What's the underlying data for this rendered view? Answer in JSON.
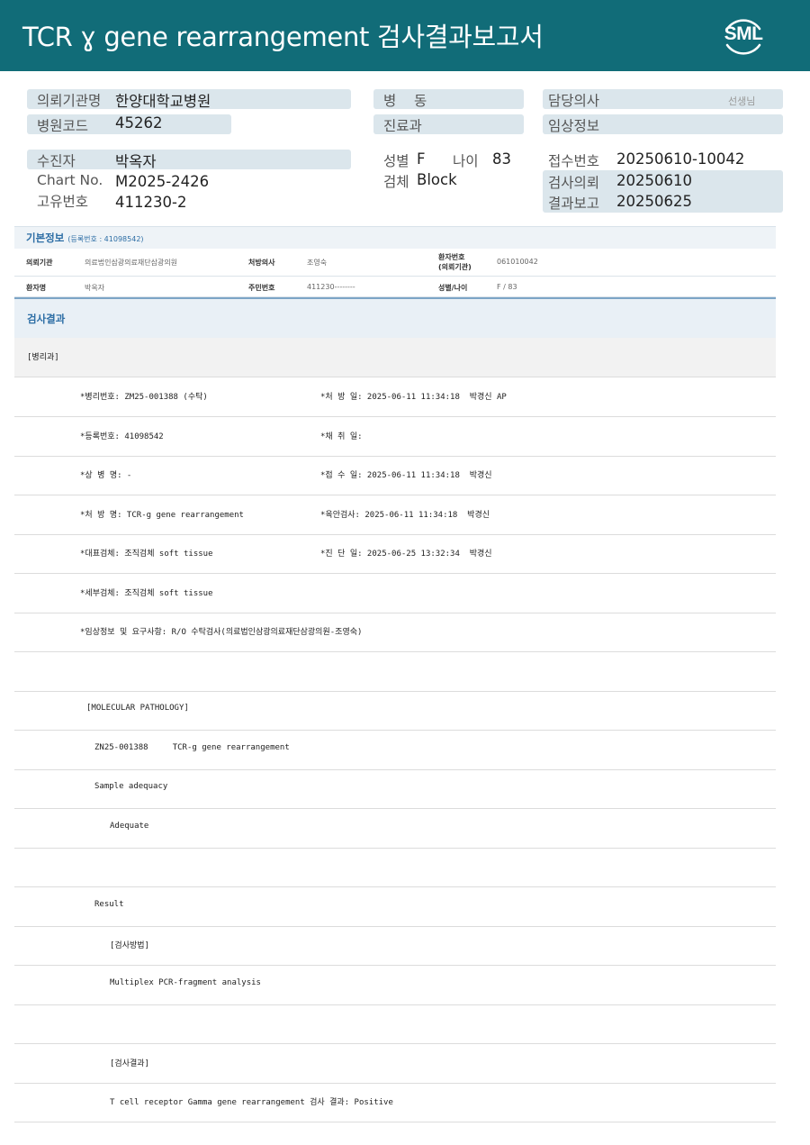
{
  "header": {
    "title": "TCR ɣ gene rearrangement 검사결과보고서",
    "logo_text": "SML"
  },
  "info": {
    "institution_label": "의뢰기관명",
    "institution_value": "한양대학교병원",
    "hospital_code_label": "병원코드",
    "hospital_code_value": "45262",
    "ward_label": "병    동",
    "department_label": "진료과",
    "doctor_label": "담당의사",
    "doctor_suffix": "선생님",
    "clinical_label": "임상정보",
    "patient_label": "수진자",
    "patient_value": "박옥자",
    "chart_label": "Chart No.",
    "chart_value": "M2025-2426",
    "unique_label": "고유번호",
    "unique_value": "411230-2",
    "sex_label": "성별",
    "sex_value": "F",
    "age_label": "나이",
    "age_value": "83",
    "specimen_label": "검체",
    "specimen_value": "Block",
    "receipt_label": "접수번호",
    "receipt_value": "20250610-10042",
    "request_label": "검사의뢰",
    "request_value": "20250610",
    "report_label": "결과보고",
    "report_value": "20250625"
  },
  "basic": {
    "title": "기본정보",
    "reg_no": "(등록번호 : 41098542)",
    "rows": [
      {
        "k1": "의뢰기관",
        "v1": "의료법인삼광의료재단삼광의원",
        "k2": "처방의사",
        "v2": "조영숙",
        "k3a": "환자번호",
        "k3b": "(의뢰기관)",
        "v3": "061010042"
      },
      {
        "k1": "환자명",
        "v1": "박옥자",
        "k2": "주민번호",
        "v2": "411230--------",
        "k3a": "성별/나이",
        "k3b": "",
        "v3": "F / 83"
      }
    ]
  },
  "result": {
    "title": "검사결과",
    "pathology_title": "[병리과]",
    "lines": [
      {
        "a": "*병리번호: ZM25-001388 (수탁)",
        "b": "*처 방 일: 2025-06-11 11:34:18  박경신 AP"
      },
      {
        "a": "*등록번호: 41098542",
        "b": "*채 취 일:"
      },
      {
        "a": "*상 병 명: -",
        "b": "*접 수 일: 2025-06-11 11:34:18  박경신"
      },
      {
        "a": "*처 방 명: TCR-g gene rearrangement",
        "b": "*육안검사: 2025-06-11 11:34:18  박경신"
      },
      {
        "a": "*대표검체: 조직검체 soft tissue",
        "b": "*진 단 일: 2025-06-25 13:32:34  박경신"
      },
      {
        "a": "*세부검체: 조직검체 soft tissue",
        "b": ""
      },
      {
        "a": "*임상정보 및 요구사항: R/O 수탁검사(의료법인삼광의료재단삼광의원-조영숙)",
        "b": ""
      }
    ],
    "body": [
      {
        "indent": 0,
        "text": ""
      },
      {
        "indent": 1,
        "text": "[MOLECULAR PATHOLOGY]"
      },
      {
        "indent": 2,
        "text": "ZN25-001388     TCR-g gene rearrangement"
      },
      {
        "indent": 2,
        "text": "Sample adequacy"
      },
      {
        "indent": 3,
        "text": "Adequate"
      },
      {
        "indent": 0,
        "text": ""
      },
      {
        "indent": 2,
        "text": "Result"
      },
      {
        "indent": 3,
        "text": "[검사방법]"
      },
      {
        "indent": 3,
        "text": "Multiplex PCR-fragment analysis"
      },
      {
        "indent": 0,
        "text": ""
      },
      {
        "indent": 3,
        "text": "[검사결과]"
      },
      {
        "indent": 3,
        "text": "T cell receptor Gamma gene rearrangement 검사 결과: Positive"
      }
    ]
  }
}
